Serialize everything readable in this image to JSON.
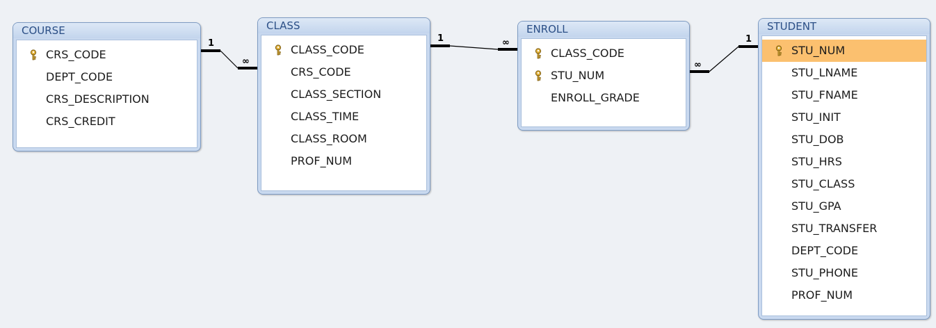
{
  "colors": {
    "background": "#eef1f5",
    "table_border": "#7e9bc2",
    "title_text": "#2b4f86",
    "selected_row": "#fbc06f",
    "line": "#000000"
  },
  "tables": [
    {
      "name": "COURSE",
      "fields": [
        {
          "name": "CRS_CODE",
          "key": true,
          "selected": false
        },
        {
          "name": "DEPT_CODE",
          "key": false,
          "selected": false
        },
        {
          "name": "CRS_DESCRIPTION",
          "key": false,
          "selected": false
        },
        {
          "name": "CRS_CREDIT",
          "key": false,
          "selected": false
        }
      ]
    },
    {
      "name": "CLASS",
      "fields": [
        {
          "name": "CLASS_CODE",
          "key": true,
          "selected": false
        },
        {
          "name": "CRS_CODE",
          "key": false,
          "selected": false
        },
        {
          "name": "CLASS_SECTION",
          "key": false,
          "selected": false
        },
        {
          "name": "CLASS_TIME",
          "key": false,
          "selected": false
        },
        {
          "name": "CLASS_ROOM",
          "key": false,
          "selected": false
        },
        {
          "name": "PROF_NUM",
          "key": false,
          "selected": false
        }
      ]
    },
    {
      "name": "ENROLL",
      "fields": [
        {
          "name": "CLASS_CODE",
          "key": true,
          "selected": false
        },
        {
          "name": "STU_NUM",
          "key": true,
          "selected": false
        },
        {
          "name": "ENROLL_GRADE",
          "key": false,
          "selected": false
        }
      ]
    },
    {
      "name": "STUDENT",
      "fields": [
        {
          "name": "STU_NUM",
          "key": true,
          "selected": true
        },
        {
          "name": "STU_LNAME",
          "key": false,
          "selected": false
        },
        {
          "name": "STU_FNAME",
          "key": false,
          "selected": false
        },
        {
          "name": "STU_INIT",
          "key": false,
          "selected": false
        },
        {
          "name": "STU_DOB",
          "key": false,
          "selected": false
        },
        {
          "name": "STU_HRS",
          "key": false,
          "selected": false
        },
        {
          "name": "STU_CLASS",
          "key": false,
          "selected": false
        },
        {
          "name": "STU_GPA",
          "key": false,
          "selected": false
        },
        {
          "name": "STU_TRANSFER",
          "key": false,
          "selected": false
        },
        {
          "name": "DEPT_CODE",
          "key": false,
          "selected": false
        },
        {
          "name": "STU_PHONE",
          "key": false,
          "selected": false
        },
        {
          "name": "PROF_NUM",
          "key": false,
          "selected": false
        }
      ]
    }
  ],
  "relationships": [
    {
      "from_table": "COURSE",
      "to_table": "CLASS",
      "from_label": "1",
      "to_label": "∞"
    },
    {
      "from_table": "CLASS",
      "to_table": "ENROLL",
      "from_label": "1",
      "to_label": "∞"
    },
    {
      "from_table": "STUDENT",
      "to_table": "ENROLL",
      "from_label": "1",
      "to_label": "∞"
    }
  ]
}
